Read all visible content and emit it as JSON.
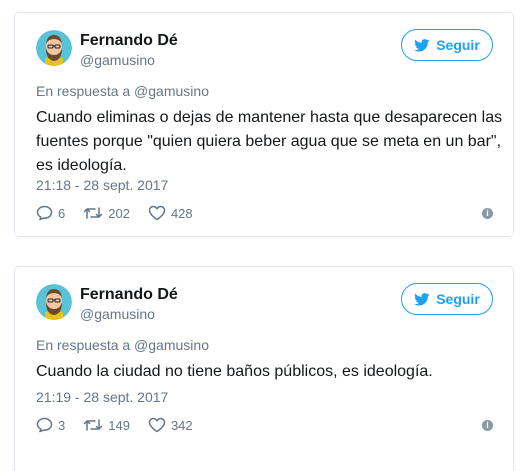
{
  "colors": {
    "accent": "#1da1f2",
    "muted": "#657786",
    "border": "#e1e8ed"
  },
  "tweets": [
    {
      "author_name": "Fernando Dé",
      "author_handle": "@gamusino",
      "follow_label": "Seguir",
      "reply_to": "En respuesta a @gamusino",
      "text": "Cuando eliminas o dejas de mantener hasta que desaparecen las fuentes porque \"quien quiera beber agua que se meta en un bar\", es ideología.",
      "timestamp": "21:18 - 28 sept. 2017",
      "replies": "6",
      "retweets": "202",
      "likes": "428",
      "icons": [
        "twitter-bird-icon",
        "reply-icon",
        "retweet-icon",
        "heart-icon",
        "info-icon"
      ]
    },
    {
      "author_name": "Fernando Dé",
      "author_handle": "@gamusino",
      "follow_label": "Seguir",
      "reply_to": "En respuesta a @gamusino",
      "text": "Cuando la ciudad no tiene baños públicos, es ideología.",
      "timestamp": "21:19 - 28 sept. 2017",
      "replies": "3",
      "retweets": "149",
      "likes": "342",
      "icons": [
        "twitter-bird-icon",
        "reply-icon",
        "retweet-icon",
        "heart-icon",
        "info-icon"
      ]
    }
  ]
}
